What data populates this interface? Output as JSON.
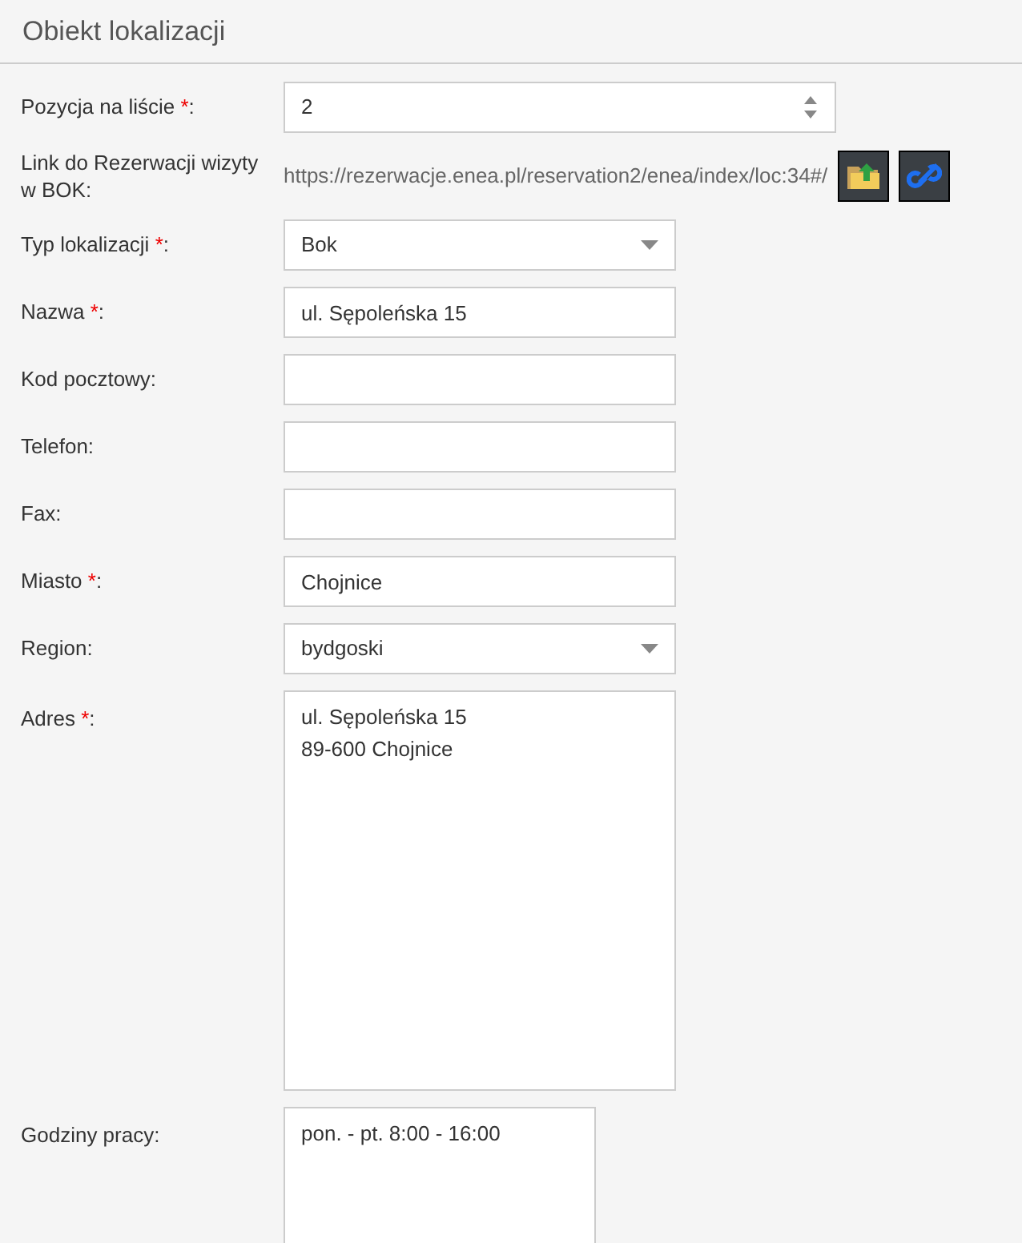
{
  "title": "Obiekt lokalizacji",
  "fields": [
    {
      "kind": "number",
      "label": "Pozycja na liście ",
      "mark": "*",
      "colon": ":",
      "value": "2"
    },
    {
      "kind": "link",
      "label": "Link do Rezerwacji wizyty w BOK:",
      "value": "https://rezerwacje.enea.pl/reservation2/enea/index/loc:34#/"
    },
    {
      "kind": "select",
      "label": "Typ lokalizacji ",
      "mark": "*",
      "colon": ":",
      "value": "Bok"
    },
    {
      "kind": "text",
      "label": "Nazwa ",
      "mark": "*",
      "colon": ":",
      "value": "ul. Sępoleńska 15"
    },
    {
      "kind": "text",
      "label": "Kod pocztowy:"
    },
    {
      "kind": "text",
      "label": "Telefon:"
    },
    {
      "kind": "text",
      "label": "Fax:"
    },
    {
      "kind": "text",
      "label": "Miasto ",
      "mark": "*",
      "colon": ":",
      "value": "Chojnice"
    },
    {
      "kind": "select",
      "label": "Region:",
      "value": "bydgoski"
    },
    {
      "kind": "textarea",
      "label": "Adres ",
      "mark": "*",
      "colon": ":",
      "value": "ul. Sępoleńska 15\n89-600 Chojnice"
    },
    {
      "kind": "hours",
      "label": "Godziny pracy:",
      "value": "pon. - pt. 8:00 - 16:00"
    }
  ]
}
